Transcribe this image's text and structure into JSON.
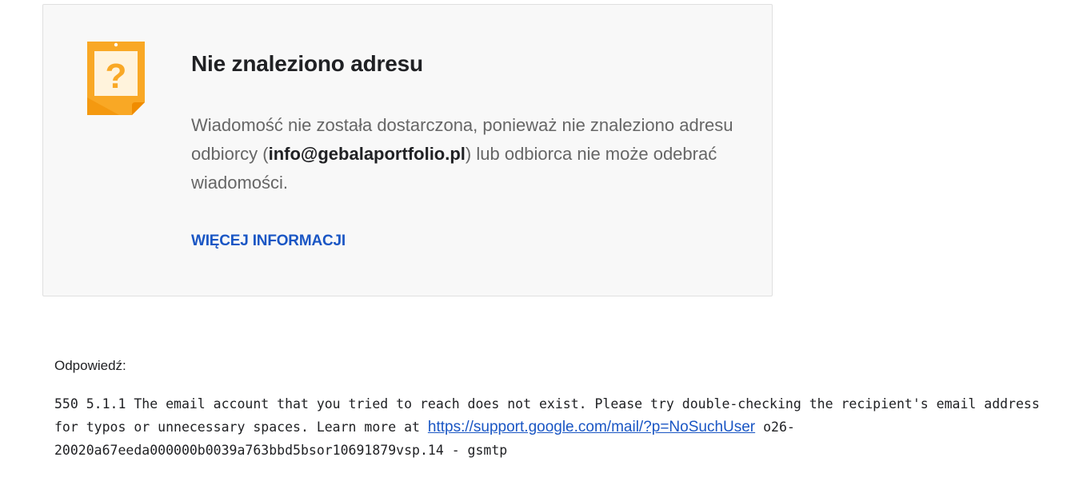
{
  "card": {
    "icon": "sticky-note-question-icon",
    "title": "Nie znaleziono adresu",
    "message_before": "Wiadomość nie została dostarczona, ponieważ nie znaleziono adresu odbiorcy (",
    "recipient": "info@gebalaportfolio.pl",
    "message_after": ") lub odbiorca nie może odebrać wiadomości.",
    "more_info_label": "WIĘCEJ INFORMACJI"
  },
  "response": {
    "label": "Odpowiedź:",
    "text_before": "550 5.1.1 The email account that you tried to reach does not exist. Please try double-checking the recipient's email address for typos or unnecessary spaces. Learn more at ",
    "link": "https://support.google.com/mail/?p=NoSuchUser",
    "text_after": " o26-20020a67eeda000000b0039a763bbd5bsor10691879vsp.14 - gsmtp"
  },
  "colors": {
    "icon_orange": "#f9a825",
    "icon_dark_orange": "#f08c00",
    "icon_paper": "#fff3dc",
    "link_blue": "#1a56c4",
    "card_bg": "#f8f8f8"
  }
}
